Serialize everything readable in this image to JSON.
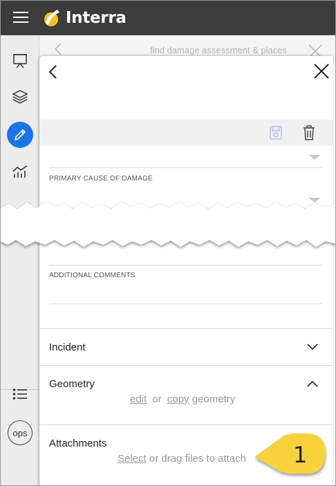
{
  "app": {
    "brand": "Interra"
  },
  "background_search": {
    "placeholder": "find damage assessment & places"
  },
  "fields": {
    "primary_cause_label": "PRIMARY CAUSE OF DAMAGE",
    "additional_comments_label": "ADDITIONAL COMMENTS"
  },
  "sections": {
    "incident": {
      "title": "Incident"
    },
    "geometry": {
      "title": "Geometry",
      "edit_link": "edit",
      "or_text": "or",
      "copy_link": "copy",
      "suffix_text": "geometry"
    },
    "attachments": {
      "title": "Attachments",
      "select_link": "Select",
      "rest_text": "or drag files to attach"
    }
  },
  "rail": {
    "items": [
      {
        "icon": "presentation-board-icon"
      },
      {
        "icon": "layers-icon"
      },
      {
        "icon": "pencil-icon",
        "active": true
      },
      {
        "icon": "analytics-chart-icon"
      },
      {
        "icon": "list-icon"
      }
    ],
    "ops_label": "ops"
  },
  "callout": {
    "number": "1"
  },
  "colors": {
    "topbar": "#3c3c3c",
    "accent": "#1a73e8",
    "logo_yellow": "#f5c518",
    "callout": "#f7d23e"
  }
}
